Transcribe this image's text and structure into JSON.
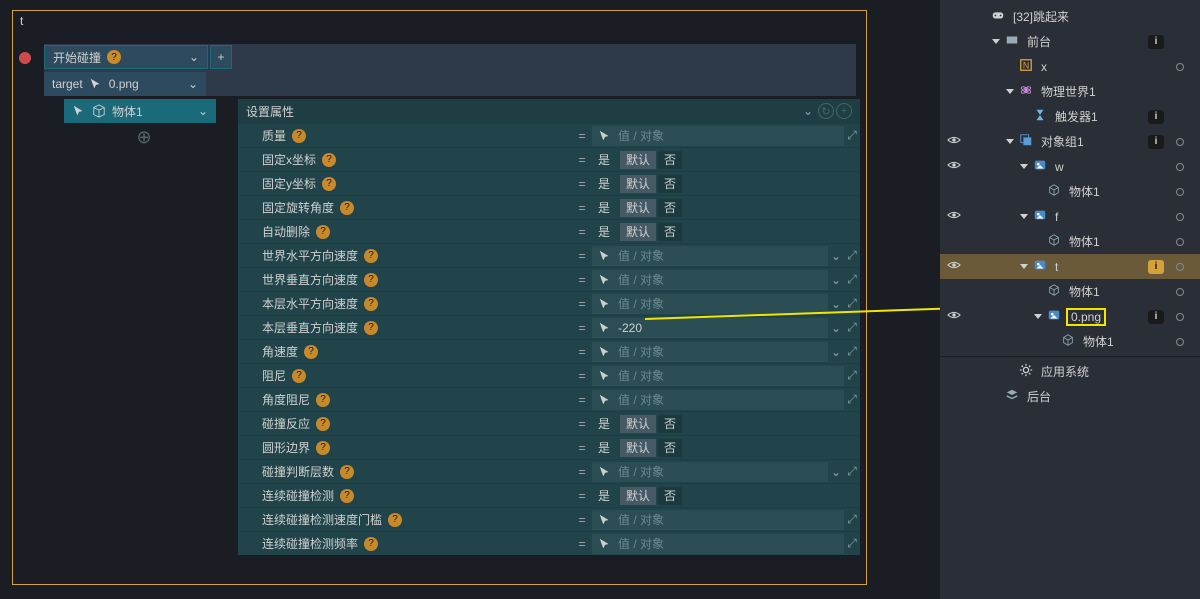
{
  "top_label": "t",
  "event": {
    "title": "开始碰撞",
    "target_label": "target",
    "target_value": "0.png"
  },
  "body": {
    "label": "物体1"
  },
  "panel": {
    "title": "设置属性",
    "placeholder": "值 / 对象",
    "yes": "是",
    "def": "默认",
    "no": "否",
    "val_220": "-220",
    "rows": [
      {
        "label": "质量",
        "type": "value"
      },
      {
        "label": "固定x坐标",
        "type": "toggle"
      },
      {
        "label": "固定y坐标",
        "type": "toggle"
      },
      {
        "label": "固定旋转角度",
        "type": "toggle"
      },
      {
        "label": "自动删除",
        "type": "toggle"
      },
      {
        "label": "世界水平方向速度",
        "type": "value_chev"
      },
      {
        "label": "世界垂直方向速度",
        "type": "value_chev"
      },
      {
        "label": "本层水平方向速度",
        "type": "value_chev"
      },
      {
        "label": "本层垂直方向速度",
        "type": "value_input"
      },
      {
        "label": "角速度",
        "type": "value_chev"
      },
      {
        "label": "阻尼",
        "type": "value"
      },
      {
        "label": "角度阻尼",
        "type": "value"
      },
      {
        "label": "碰撞反应",
        "type": "toggle"
      },
      {
        "label": "圆形边界",
        "type": "toggle"
      },
      {
        "label": "碰撞判断层数",
        "type": "value_chev"
      },
      {
        "label": "连续碰撞检测",
        "type": "toggle"
      },
      {
        "label": "连续碰撞检测速度门槛",
        "type": "value"
      },
      {
        "label": "连续碰撞检测频率",
        "type": "value"
      }
    ]
  },
  "tree": {
    "items": [
      {
        "indent": 0,
        "icon": "controller",
        "label": "[32]跳起来",
        "info": false,
        "eye": false,
        "chev": false,
        "circle": false
      },
      {
        "indent": 1,
        "icon": "layer",
        "label": "前台",
        "info": true,
        "eye": false,
        "chev": true,
        "circle": false
      },
      {
        "indent": 2,
        "icon": "n-box",
        "label": "x",
        "info": false,
        "eye": false,
        "chev": false,
        "circle": true
      },
      {
        "indent": 2,
        "icon": "physics",
        "label": "物理世界1",
        "info": false,
        "eye": false,
        "chev": true,
        "circle": false
      },
      {
        "indent": 3,
        "icon": "hourglass",
        "label": "触发器1",
        "info": true,
        "eye": false,
        "chev": false,
        "circle": false
      },
      {
        "indent": 2,
        "icon": "group",
        "label": "对象组1",
        "info": true,
        "eye": true,
        "chev": true,
        "circle": true
      },
      {
        "indent": 3,
        "icon": "img",
        "label": "w",
        "info": false,
        "eye": true,
        "chev": true,
        "circle": true
      },
      {
        "indent": 4,
        "icon": "cube",
        "label": "物体1",
        "info": false,
        "eye": false,
        "chev": false,
        "circle": true
      },
      {
        "indent": 3,
        "icon": "img",
        "label": "f",
        "info": false,
        "eye": true,
        "chev": true,
        "circle": true
      },
      {
        "indent": 4,
        "icon": "cube",
        "label": "物体1",
        "info": false,
        "eye": false,
        "chev": false,
        "circle": true
      },
      {
        "indent": 3,
        "icon": "img",
        "label": "t",
        "info": "orange",
        "eye": true,
        "chev": true,
        "circle": true,
        "selected": true
      },
      {
        "indent": 4,
        "icon": "cube",
        "label": "物体1",
        "info": false,
        "eye": false,
        "chev": false,
        "circle": true
      },
      {
        "indent": 4,
        "icon": "img",
        "label": "0.png",
        "info": true,
        "eye": true,
        "chev": true,
        "circle": true,
        "highlight": true
      },
      {
        "indent": 5,
        "icon": "cube",
        "label": "物体1",
        "info": false,
        "eye": false,
        "chev": false,
        "circle": true
      },
      {
        "indent": 2,
        "icon": "gear",
        "label": "应用系统",
        "info": false,
        "eye": false,
        "chev": false,
        "circle": false
      },
      {
        "indent": 1,
        "icon": "stack",
        "label": "后台",
        "info": false,
        "eye": false,
        "chev": false,
        "circle": false
      }
    ]
  }
}
